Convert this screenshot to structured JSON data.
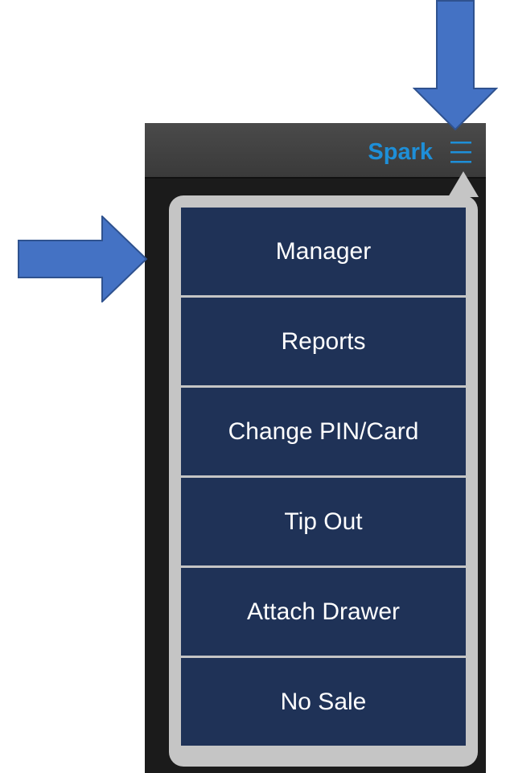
{
  "header": {
    "app_title": "Spark",
    "menu_icon": "hamburger-menu-icon",
    "title_color": "#1e8fd8"
  },
  "menu": {
    "items": [
      {
        "label": "Manager"
      },
      {
        "label": "Reports"
      },
      {
        "label": "Change PIN/Card"
      },
      {
        "label": "Tip Out"
      },
      {
        "label": "Attach Drawer"
      },
      {
        "label": "No Sale"
      }
    ],
    "item_color": "#1f3257",
    "frame_color": "#c5c5c5"
  },
  "annotations": {
    "arrow_color": "#4472c4",
    "arrows": [
      "arrow-down-icon",
      "arrow-right-icon"
    ]
  }
}
